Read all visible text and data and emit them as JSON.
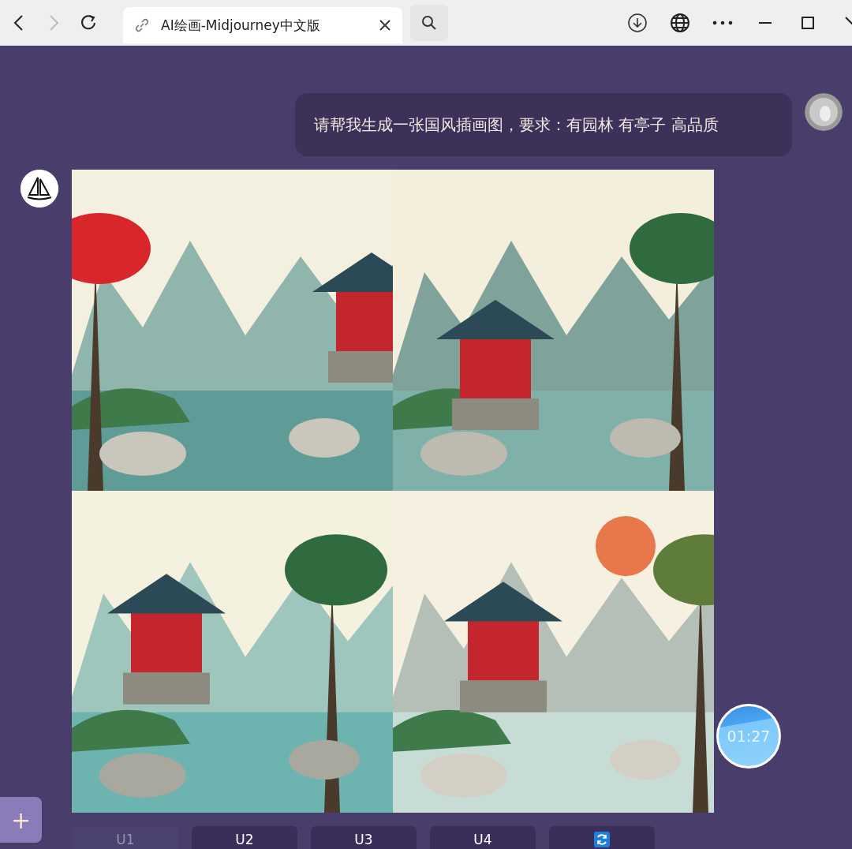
{
  "browser": {
    "tab_title": "AI绘画-Midjourney中文版"
  },
  "chat": {
    "user_message": "请帮我生成一张国风插画图，要求：有园林 有亭子 高品质",
    "actions": [
      {
        "kind": "text",
        "label": "U1",
        "disabled": true
      },
      {
        "kind": "text",
        "label": "U2",
        "disabled": false
      },
      {
        "kind": "text",
        "label": "U3",
        "disabled": false
      },
      {
        "kind": "text",
        "label": "U4",
        "disabled": false
      },
      {
        "kind": "refresh",
        "disabled": false
      }
    ]
  },
  "timer": {
    "time": "01:27"
  },
  "add_button": {
    "label": "+"
  }
}
